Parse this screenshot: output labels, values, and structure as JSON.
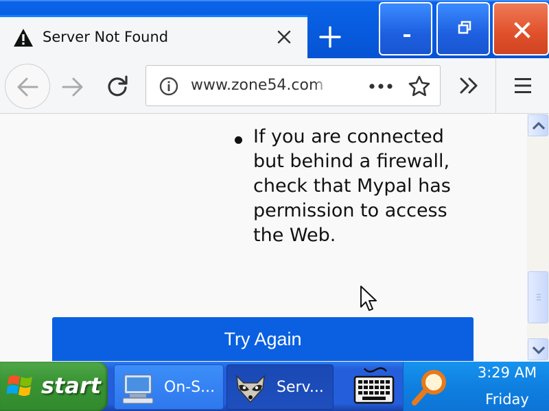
{
  "browser": {
    "tab": {
      "title": "Server Not Found",
      "icon": "warning-icon"
    },
    "new_tab_icon": "plus-icon",
    "window_controls": {
      "minimize": "-",
      "maximize_icon": "restore-icon",
      "close_icon": "close-icon"
    },
    "toolbar": {
      "back_icon": "back-arrow-icon",
      "forward_icon": "forward-arrow-icon",
      "reload_icon": "reload-icon",
      "url": "www.zone54.com",
      "info_icon": "info-icon",
      "page_actions_icon": "more-dots-icon",
      "bookmark_icon": "star-icon",
      "overflow_icon": "double-chevron-icon",
      "menu_icon": "hamburger-menu-icon"
    }
  },
  "content": {
    "bullet_text": "If you are connected but behind a firewall, check that Mypal has permission to access the Web.",
    "try_again_label": "Try Again"
  },
  "taskbar": {
    "start_label": "start",
    "tasks": [
      {
        "label": "On-S...",
        "icon": "onscreen-keyboard-monitor-icon"
      },
      {
        "label": "Serv...",
        "icon": "raccoon-mypal-icon"
      }
    ],
    "quicklaunch_icon": "keyboard-icon",
    "tray_icon": "search-magnifier-icon",
    "clock": {
      "time": "3:29 AM",
      "day": "Friday"
    }
  },
  "colors": {
    "accent_blue": "#0a60e0",
    "tab_border": "#0a84ff",
    "close_red": "#e0502a",
    "start_green": "#3a9534"
  }
}
